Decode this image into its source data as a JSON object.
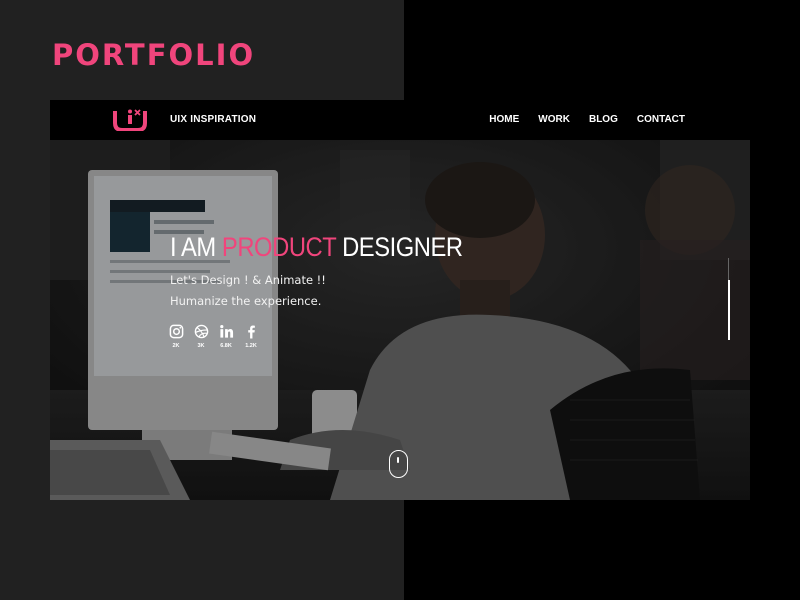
{
  "page": {
    "heading": "PORTFOLIO"
  },
  "navbar": {
    "logo_icon": "uix-logo-icon",
    "brand": "UIX INSPIRATION",
    "links": [
      "HOME",
      "WORK",
      "BLOG",
      "CONTACT"
    ]
  },
  "hero": {
    "title_prefix": "I AM ",
    "title_accent": "PRODUCT",
    "title_suffix": " DESIGNER",
    "tagline_line1": "Let's Design ! & Animate !!",
    "tagline_line2": "Humanize the experience.",
    "socials": [
      {
        "icon": "instagram-icon",
        "count": "2K"
      },
      {
        "icon": "dribbble-icon",
        "count": "3K"
      },
      {
        "icon": "linkedin-icon",
        "count": "6.8K"
      },
      {
        "icon": "facebook-icon",
        "count": "1.2K"
      }
    ],
    "scroll_icon": "mouse-scroll-icon"
  },
  "colors": {
    "accent": "#f0457c",
    "dark_left": "#212121",
    "dark_right": "#000000",
    "text": "#ffffff"
  }
}
